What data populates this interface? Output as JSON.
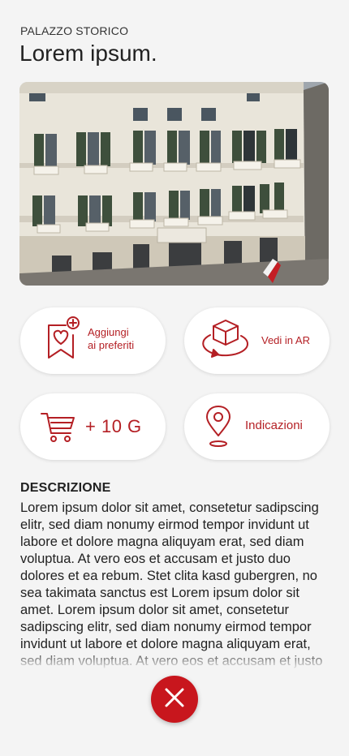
{
  "header": {
    "eyebrow": "PALAZZO STORICO",
    "title": "Lorem ipsum."
  },
  "actions": {
    "favorites_line1": "Aggiungi",
    "favorites_line2": "ai preferiti",
    "ar_label": "Vedi in AR",
    "cart_label": "+ 10 G",
    "directions_label": "Indicazioni"
  },
  "description": {
    "heading": "DESCRIZIONE",
    "text": "Lorem ipsum dolor sit amet, consetetur sadipscing elitr, sed diam nonumy eirmod tempor invidunt ut labore et dolore magna aliquyam erat, sed diam voluptua. At vero eos et accusam et justo duo dolores et ea rebum. Stet clita kasd gubergren, no sea takimata sanctus est Lorem ipsum dolor sit amet. Lorem ipsum dolor sit amet, consetetur sadipscing elitr, sed diam nonumy eirmod tempor invidunt ut labore et dolore magna aliquyam erat, sed diam voluptua. At vero eos et accusam et justo"
  },
  "icons": {
    "favorites": "heart-bookmark-icon",
    "ar": "ar-cube-icon",
    "cart": "cart-icon",
    "directions": "location-pin-icon",
    "close": "close-icon"
  },
  "colors": {
    "accent": "#b41f24",
    "close_button": "#c8161d",
    "background": "#f4f4f4"
  }
}
